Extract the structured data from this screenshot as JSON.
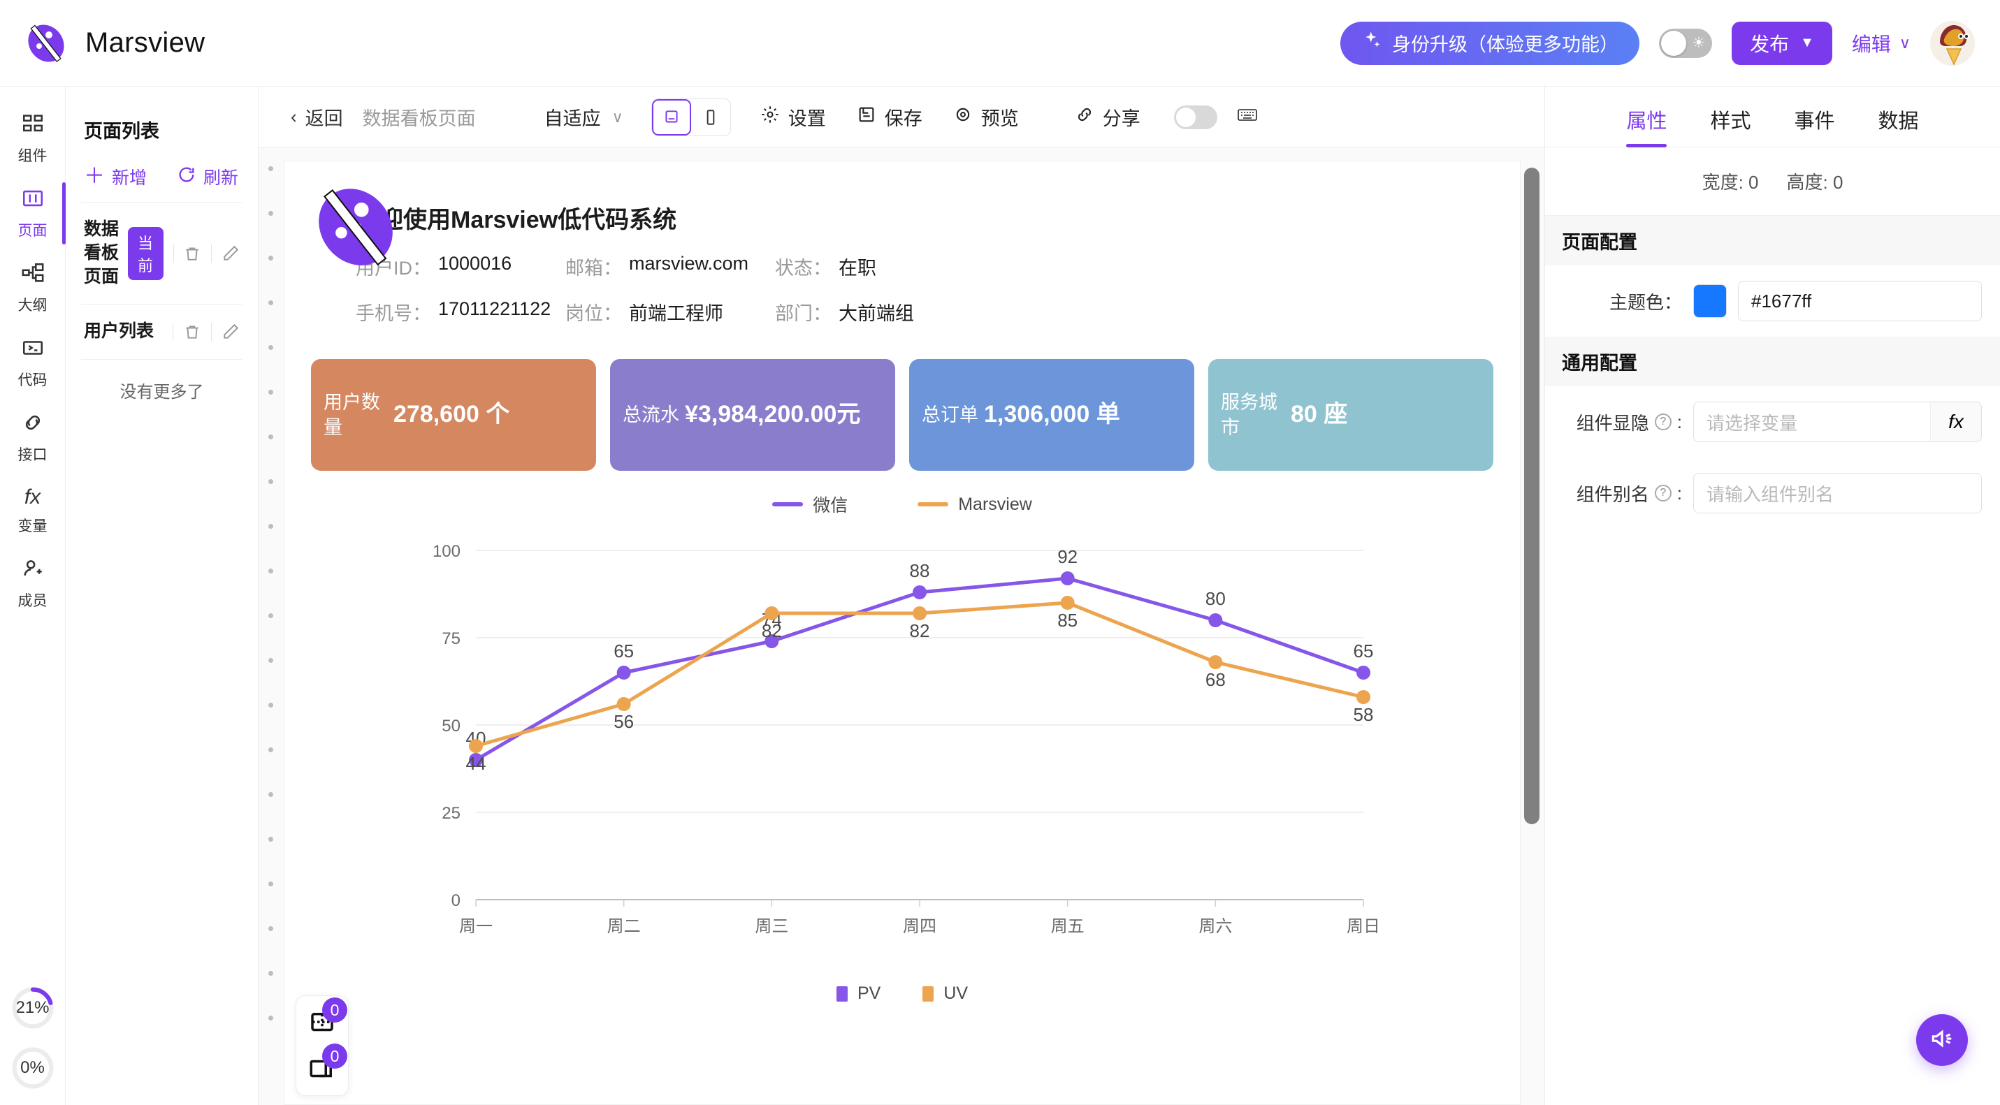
{
  "topbar": {
    "brand_name": "Marsview",
    "upgrade_label": "身份升级（体验更多功能）",
    "publish_label": "发布",
    "edit_label": "编辑",
    "accent": "#7c3aed"
  },
  "rail": {
    "items": [
      {
        "label": "组件",
        "icon": "grid-icon",
        "active": false
      },
      {
        "label": "页面",
        "icon": "page-icon",
        "active": true
      },
      {
        "label": "大纲",
        "icon": "outline-icon",
        "active": false
      },
      {
        "label": "代码",
        "icon": "code-icon",
        "active": false
      },
      {
        "label": "接口",
        "icon": "api-icon",
        "active": false
      },
      {
        "label": "变量",
        "icon": "fx-icon",
        "active": false
      },
      {
        "label": "成员",
        "icon": "member-icon",
        "active": false
      }
    ],
    "progress": [
      {
        "label": "21%",
        "value": 21
      },
      {
        "label": "0%",
        "value": 0
      }
    ]
  },
  "pagelist": {
    "title": "页面列表",
    "add_label": "新增",
    "refresh_label": "刷新",
    "rows": [
      {
        "name": "数据看板页面",
        "badge": "当前"
      },
      {
        "name": "用户列表",
        "badge": ""
      }
    ],
    "footer": "没有更多了"
  },
  "toolbar": {
    "back_label": "返回",
    "page_title": "数据看板页面",
    "responsive_label": "自适应",
    "settings_label": "设置",
    "save_label": "保存",
    "preview_label": "预览",
    "share_label": "分享"
  },
  "canvas": {
    "page_title": "欢迎使用Marsview低代码系统",
    "info": [
      [
        {
          "key": "用户ID：",
          "value": "1000016"
        },
        {
          "key": "邮箱：",
          "value": "marsview.com"
        },
        {
          "key": "状态：",
          "value": "在职"
        }
      ],
      [
        {
          "key": "手机号：",
          "value": "17011221122"
        },
        {
          "key": "岗位：",
          "value": "前端工程师"
        },
        {
          "key": "部门：",
          "value": "大前端组"
        }
      ]
    ],
    "cards": [
      {
        "label": "用户数量",
        "value": "278,600 个",
        "color": "#d58760"
      },
      {
        "label": "总流水",
        "value": "¥3,984,200.00元",
        "color": "#8a7dcb"
      },
      {
        "label": "总订单",
        "value": "1,306,000 单",
        "color": "#6d95d9"
      },
      {
        "label": "服务城市",
        "value": "80 座",
        "color": "#8fc3cf"
      }
    ],
    "float_buttons": [
      {
        "icon": "layout-grid-icon",
        "count": "0"
      },
      {
        "icon": "layers-icon",
        "count": "0"
      }
    ]
  },
  "chart_data": {
    "type": "line",
    "title": "",
    "xlabel": "",
    "ylabel": "",
    "categories": [
      "周一",
      "周二",
      "周三",
      "周四",
      "周五",
      "周六",
      "周日"
    ],
    "series": [
      {
        "name": "微信",
        "color": "#8556e8",
        "values": [
          40,
          65,
          74,
          88,
          92,
          80,
          65
        ]
      },
      {
        "name": "Marsview",
        "color": "#eda44e",
        "values": [
          44,
          56,
          82,
          82,
          85,
          68,
          58
        ]
      }
    ],
    "yticks": [
      0,
      25,
      50,
      75,
      100
    ],
    "ylim": [
      0,
      100
    ],
    "grid": true,
    "legend_top": [
      "微信",
      "Marsview"
    ],
    "legend_bottom": [
      {
        "label": "PV",
        "color": "#8556e8"
      },
      {
        "label": "UV",
        "color": "#eda44e"
      }
    ]
  },
  "props": {
    "tabs": [
      {
        "label": "属性",
        "active": true
      },
      {
        "label": "样式",
        "active": false
      },
      {
        "label": "事件",
        "active": false
      },
      {
        "label": "数据",
        "active": false
      }
    ],
    "size": {
      "width_label": "宽度: 0",
      "height_label": "高度: 0"
    },
    "page_section_title": "页面配置",
    "theme_color_label": "主题色：",
    "theme_color_value": "#1677ff",
    "theme_color_hex": "#1677ff",
    "common_section_title": "通用配置",
    "visible_label": "组件显隐",
    "visible_placeholder": "请选择变量",
    "fx_label": "fx",
    "alias_label": "组件别名",
    "alias_placeholder": "请输入组件别名"
  }
}
